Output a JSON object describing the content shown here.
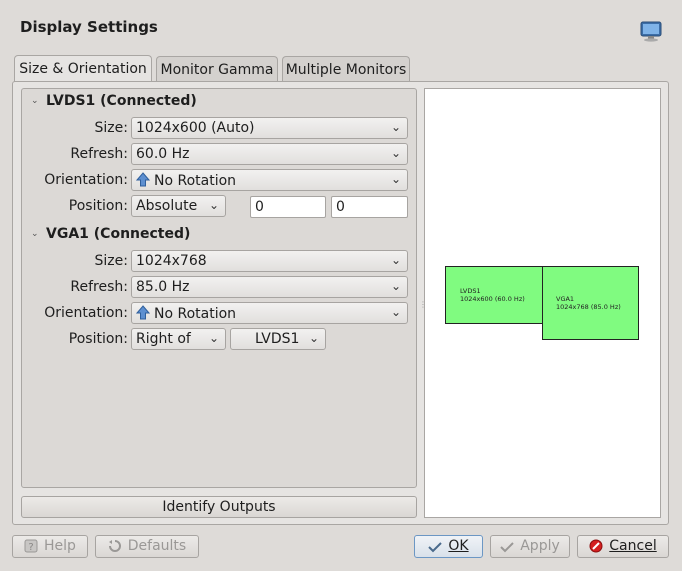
{
  "window": {
    "title": "Display Settings",
    "icon": "monitor-icon"
  },
  "tabs": [
    {
      "label": "Size & Orientation",
      "active": true
    },
    {
      "label": "Monitor Gamma",
      "active": false
    },
    {
      "label": "Multiple Monitors",
      "active": false
    }
  ],
  "outputs": [
    {
      "header": "LVDS1 (Connected)",
      "size_label": "Size:",
      "size": "1024x600 (Auto)",
      "refresh_label": "Refresh:",
      "refresh": "60.0 Hz",
      "orientation_label": "Orientation:",
      "orientation": "No Rotation",
      "position_label": "Position:",
      "position": "Absolute",
      "pos_x": "0",
      "pos_y": "0"
    },
    {
      "header": "VGA1 (Connected)",
      "size_label": "Size:",
      "size": "1024x768",
      "refresh_label": "Refresh:",
      "refresh": "85.0 Hz",
      "orientation_label": "Orientation:",
      "orientation": "No Rotation",
      "position_label": "Position:",
      "position": "Right of",
      "relative_to": "LVDS1"
    }
  ],
  "identify_button": "Identify Outputs",
  "preview": {
    "monitors": [
      {
        "name": "LVDS1",
        "info": "1024x600 (60.0 Hz)"
      },
      {
        "name": "VGA1",
        "info": "1024x768 (85.0 Hz)"
      }
    ],
    "fill_color": "#80fb80"
  },
  "buttons": {
    "help": "Help",
    "defaults": "Defaults",
    "ok": "OK",
    "apply": "Apply",
    "cancel": "Cancel"
  }
}
